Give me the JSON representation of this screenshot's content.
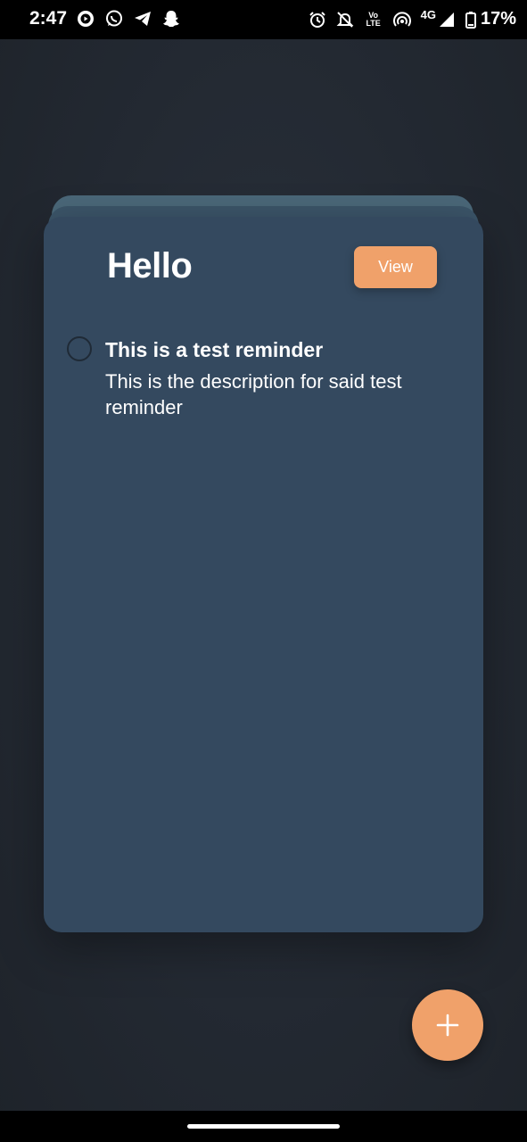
{
  "status_bar": {
    "time": "2:47",
    "network_small": "Vo LTE",
    "network_type": "4G",
    "battery": "17%",
    "left_icons": [
      "media-icon",
      "whatsapp-icon",
      "telegram-icon",
      "snapchat-icon"
    ],
    "right_icons": [
      "alarm-icon",
      "bell-off-icon",
      "volte-icon",
      "hotspot-icon",
      "signal-icon",
      "battery-icon"
    ]
  },
  "card": {
    "title": "Hello",
    "view_label": "View"
  },
  "reminders": [
    {
      "title": "This is a test reminder",
      "description": "This is the description for said test reminder",
      "done": false
    }
  ],
  "fab": {
    "icon": "plus-icon"
  },
  "colors": {
    "accent": "#f0a16a",
    "card": "#34495f",
    "background": "#232932"
  }
}
